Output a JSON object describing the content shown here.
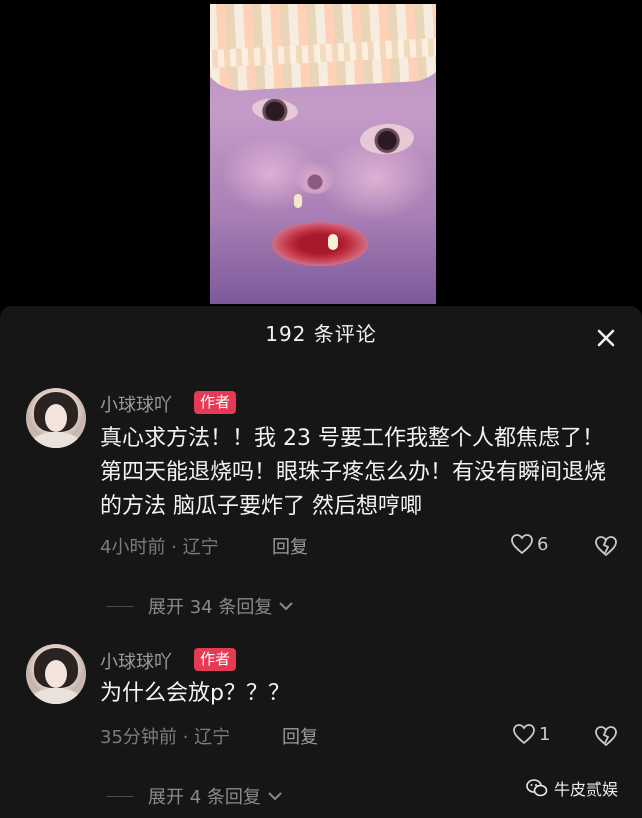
{
  "header": {
    "title": "192 条评论"
  },
  "comments": [
    {
      "username": "小球球吖",
      "badge": "作者",
      "text": "真心求方法！！我 23 号要工作我整个人都焦虑了！第四天能退烧吗！眼珠子疼怎么办！有没有瞬间退烧的方法 脑瓜子要炸了 然后想哼唧",
      "meta": "4小时前 · 辽宁",
      "reply_label": "回复",
      "likes": "6",
      "expand_label": "展开 34 条回复"
    },
    {
      "username": "小球球吖",
      "badge": "作者",
      "text": "为什么会放p？？？",
      "meta": "35分钟前 · 辽宁",
      "reply_label": "回复",
      "likes": "1",
      "expand_label": "展开 4 条回复"
    }
  ],
  "watermark": {
    "text": "牛皮贰娱",
    "icon": "wechat-icon"
  },
  "icons": {
    "close": "close-icon",
    "like": "heart-outline-icon",
    "dislike": "broken-heart-icon",
    "expand": "chevron-down-icon"
  },
  "colors": {
    "sheet_bg": "#161616",
    "badge": "#e43a54"
  }
}
